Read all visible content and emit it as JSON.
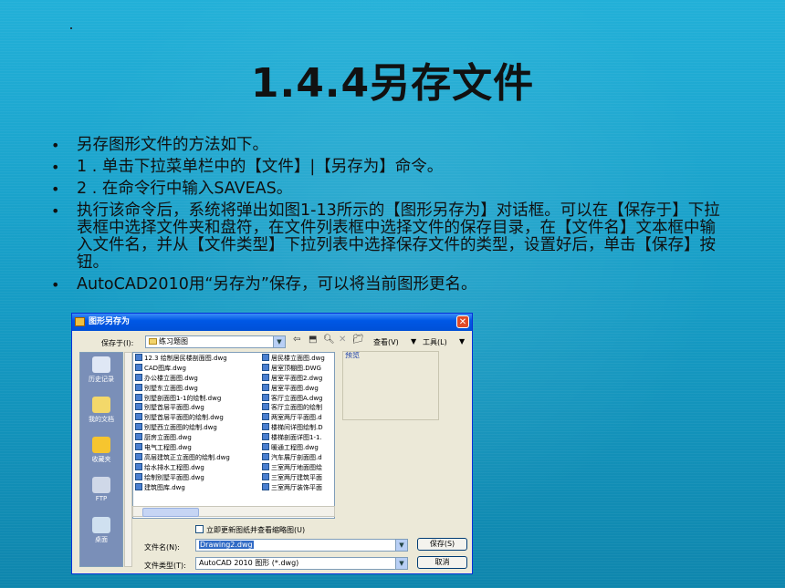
{
  "slide": {
    "title": "1.4.4另存文件",
    "bullets": [
      "另存图形文件的方法如下。",
      "1 . 单击下拉菜单栏中的【文件】|【另存为】命令。",
      "2 . 在命令行中输入SAVEAS。",
      "执行该命令后，系统将弹出如图1-13所示的【图形另存为】对话框。可以在【保存于】下拉表框中选择文件夹和盘符，在文件列表框中选择文件的保存目录，在【文件名】文本框中输入文件名，并从【文件类型】下拉列表中选择保存文件的类型，设置好后，单击【保存】按钮。",
      "AutoCAD2010用“另存为”保存，可以将当前图形更名。"
    ],
    "bullet_char": "•"
  },
  "dialog": {
    "title": "图形另存为",
    "close_glyph": "✕",
    "save_in_label": "保存于(I):",
    "save_in_value": "练习题图",
    "toolbar": {
      "views_label": "查看(V)",
      "tools_label": "工具(L)"
    },
    "preview_label": "预览",
    "places": [
      {
        "label": "历史记录"
      },
      {
        "label": "我的文档"
      },
      {
        "label": "收藏夹"
      },
      {
        "label": "FTP"
      },
      {
        "label": "桌面"
      }
    ],
    "files_col1": [
      "12.3  绘制居民楼剖面图.dwg",
      "CAD图库.dwg",
      "办公楼立面图.dwg",
      "别墅东立面图.dwg",
      "别墅剖面图1-1的绘制.dwg",
      "别墅首层平面图.dwg",
      "别墅首层平面图的绘制.dwg",
      "别墅西立面图的绘制.dwg",
      "厨房立面图.dwg",
      "电气工程图.dwg",
      "高层建筑正立面图的绘制.dwg",
      "给水排水工程图.dwg",
      "绘制别墅平面图.dwg",
      "建筑图库.dwg"
    ],
    "files_col2": [
      "居民楼立面图.dwg",
      "居室顶棚图.DWG",
      "居室平面图2.dwg",
      "居室平面图.dwg",
      "客厅立面图A.dwg",
      "客厅立面图的绘制",
      "两室两厅平面图.d",
      "楼梯间详图绘制.D",
      "楼梯剖面详图1-1.",
      "暖通工程图.dwg",
      "汽车展厅剖面图.d",
      "三室两厅地面图绘",
      "三室两厅建筑平面",
      "三室两厅装饰平面"
    ],
    "update_thumbnail_label": "立即更新图纸并查看缩略图(U)",
    "filename_label": "文件名(N):",
    "filename_value": "Drawing2.dwg",
    "filetype_label": "文件类型(T):",
    "filetype_value": "AutoCAD 2010 图形 (*.dwg)",
    "save_button": "保存(S)",
    "cancel_button": "取消"
  }
}
